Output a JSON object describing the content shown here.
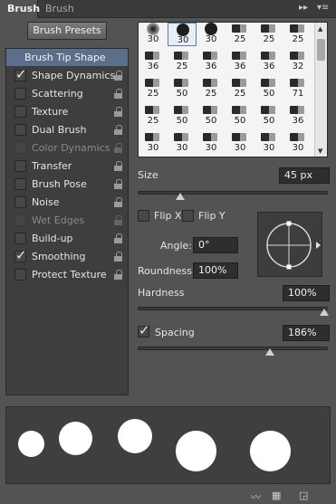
{
  "tabs": [
    {
      "label": "Brush"
    },
    {
      "label": "Brush Presets"
    }
  ],
  "presets_button": "Brush Presets",
  "tip_shape_label": "Brush Tip Shape",
  "options": [
    {
      "label": "Shape Dynamics",
      "checked": true,
      "disabled": false
    },
    {
      "label": "Scattering",
      "checked": false,
      "disabled": false
    },
    {
      "label": "Texture",
      "checked": false,
      "disabled": false
    },
    {
      "label": "Dual Brush",
      "checked": false,
      "disabled": false
    },
    {
      "label": "Color Dynamics",
      "checked": false,
      "disabled": true
    },
    {
      "label": "Transfer",
      "checked": false,
      "disabled": false
    },
    {
      "label": "Brush Pose",
      "checked": false,
      "disabled": false
    },
    {
      "label": "Noise",
      "checked": false,
      "disabled": false
    },
    {
      "label": "Wet Edges",
      "checked": false,
      "disabled": true
    },
    {
      "label": "Build-up",
      "checked": false,
      "disabled": false
    },
    {
      "label": "Smoothing",
      "checked": true,
      "disabled": false
    },
    {
      "label": "Protect Texture",
      "checked": false,
      "disabled": false
    }
  ],
  "brush_grid": [
    [
      "30",
      "30",
      "30",
      "25",
      "25",
      "25"
    ],
    [
      "36",
      "25",
      "36",
      "36",
      "36",
      "32"
    ],
    [
      "25",
      "50",
      "25",
      "25",
      "50",
      "71"
    ],
    [
      "25",
      "50",
      "50",
      "50",
      "50",
      "36"
    ],
    [
      "30",
      "30",
      "30",
      "30",
      "30",
      "30"
    ]
  ],
  "selected_brush": {
    "row": 0,
    "col": 1
  },
  "size": {
    "label": "Size",
    "value": "45 px",
    "slider": 0.23
  },
  "flip_x": {
    "label": "Flip X",
    "checked": false
  },
  "flip_y": {
    "label": "Flip Y",
    "checked": false
  },
  "angle": {
    "label": "Angle:",
    "value": "0°"
  },
  "roundness": {
    "label": "Roundness:",
    "value": "100%"
  },
  "hardness": {
    "label": "Hardness",
    "value": "100%",
    "slider": 1.0
  },
  "spacing": {
    "label": "Spacing",
    "value": "186%",
    "checked": true,
    "slider": 0.71
  },
  "preview_dots": 5
}
